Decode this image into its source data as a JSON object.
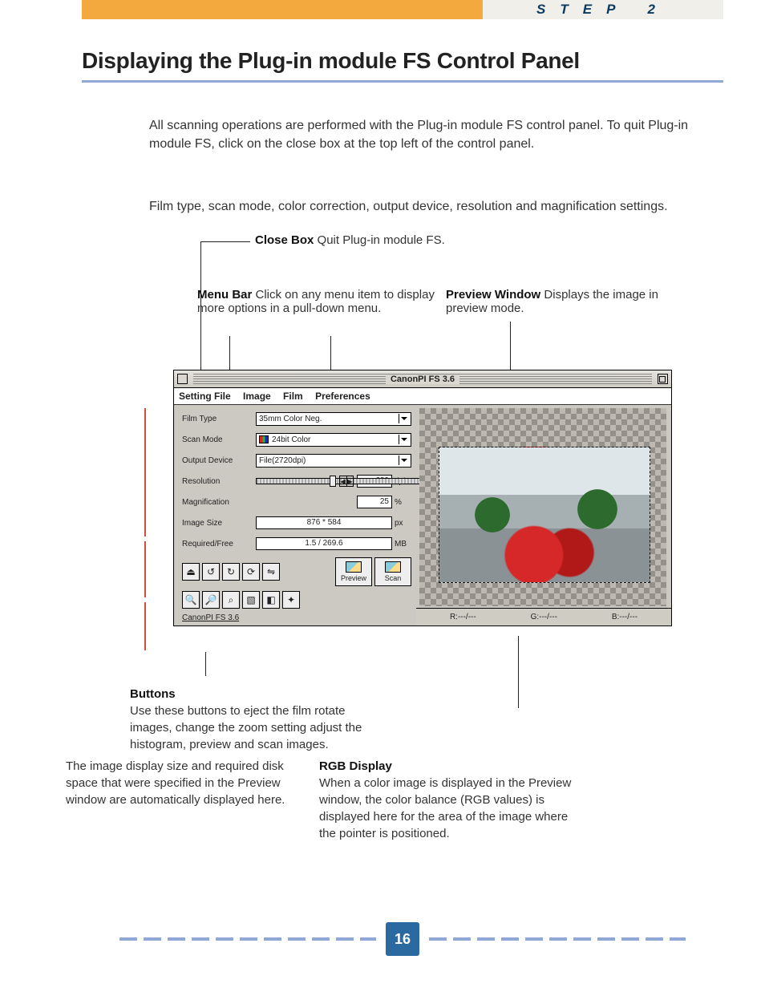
{
  "header": {
    "step_label": "STEP 2",
    "title": "Displaying the Plug-in module FS Control Panel"
  },
  "intro": "All scanning operations are performed with the Plug-in module FS control panel. To quit Plug-in module FS, click on the close box at the top left of the control panel.",
  "subintro": "Film type, scan mode, color correction, output device, resolution and magnification settings.",
  "callouts": {
    "close_box": {
      "title": "Close Box",
      "text": "Quit Plug-in module FS."
    },
    "menu_bar": {
      "title": "Menu Bar",
      "text": "Click on any menu item to display more options in a pull-down menu."
    },
    "preview_window": {
      "title": "Preview Window",
      "text": "Displays the image in preview mode."
    },
    "buttons": {
      "title": "Buttons",
      "text": "Use these buttons to eject the film rotate images, change the zoom setting adjust the histogram, preview and scan images."
    },
    "size_note": "The image display size and required disk space that were specified in the Preview window are automatically displayed here.",
    "rgb_display": {
      "title": "RGB Display",
      "text": "When a color image is displayed in the Preview window, the color balance (RGB values) is displayed here for the area of the image where the pointer is positioned."
    }
  },
  "panel": {
    "window_title": "CanonPI FS 3.6",
    "menus": [
      "Setting File",
      "Image",
      "Film",
      "Preferences"
    ],
    "fields": {
      "film_type": {
        "label": "Film Type",
        "value": "35mm Color Neg."
      },
      "scan_mode": {
        "label": "Scan Mode",
        "value": "24bit Color"
      },
      "output_device": {
        "label": "Output Device",
        "value": "File(2720dpi)"
      },
      "resolution": {
        "label": "Resolution",
        "value": "680",
        "unit": "dpi"
      },
      "magnification": {
        "label": "Magnification",
        "value": "25",
        "unit": "%"
      },
      "image_size": {
        "label": "Image Size",
        "value": "876 * 584",
        "unit": "px"
      },
      "required_free": {
        "label": "Required/Free",
        "value": "1.5 / 269.6",
        "unit": "MB"
      }
    },
    "buttons": {
      "preview": "Preview",
      "scan": "Scan"
    },
    "status_line": "CanonPI FS 3.6",
    "rgb": {
      "r": "R:---/---",
      "g": "G:---/---",
      "b": "B:---/---"
    }
  },
  "page_number": "16"
}
